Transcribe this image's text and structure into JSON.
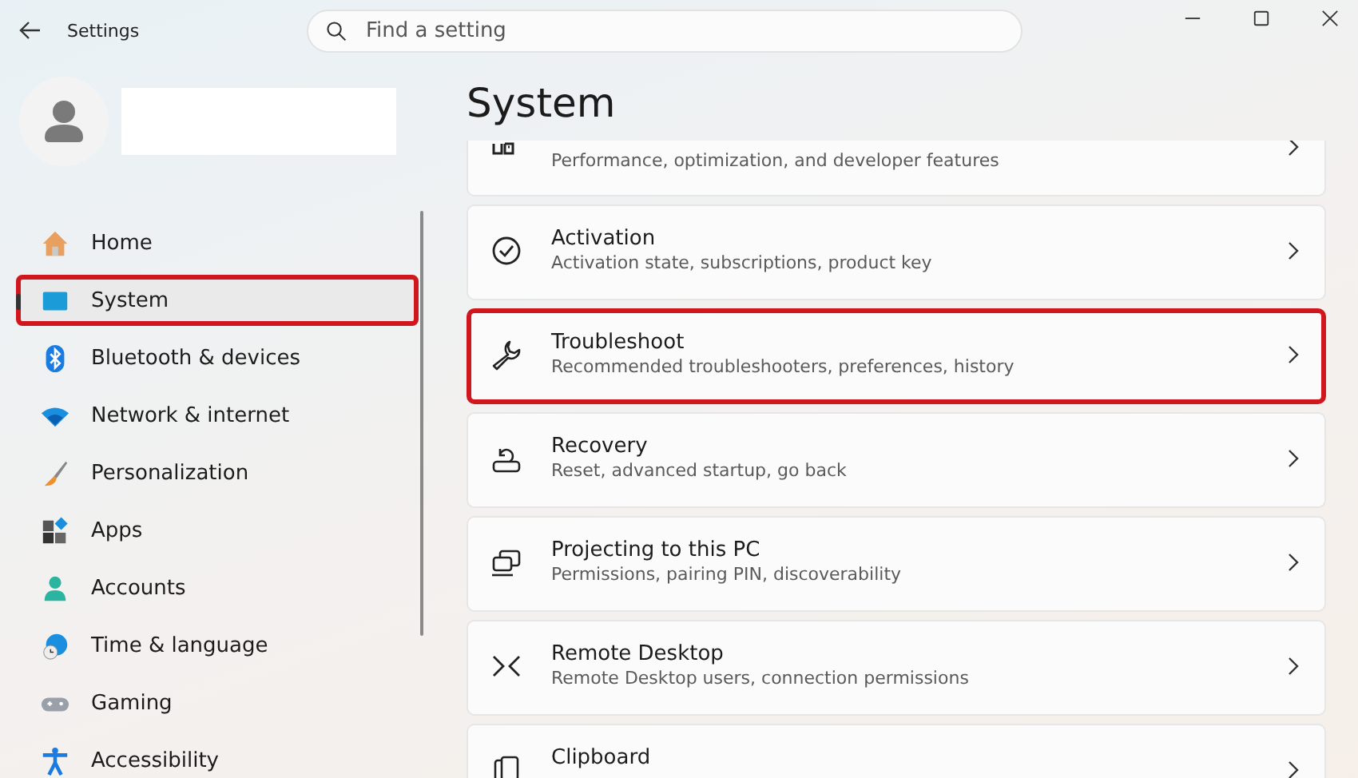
{
  "window": {
    "title": "Settings"
  },
  "search": {
    "placeholder": "Find a setting"
  },
  "account": {
    "kind": "redacted"
  },
  "sidebar": {
    "items": [
      {
        "label": "Home",
        "selected": false,
        "highlighted": false
      },
      {
        "label": "System",
        "selected": true,
        "highlighted": true
      },
      {
        "label": "Bluetooth & devices",
        "selected": false,
        "highlighted": false
      },
      {
        "label": "Network & internet",
        "selected": false,
        "highlighted": false
      },
      {
        "label": "Personalization",
        "selected": false,
        "highlighted": false
      },
      {
        "label": "Apps",
        "selected": false,
        "highlighted": false
      },
      {
        "label": "Accounts",
        "selected": false,
        "highlighted": false
      },
      {
        "label": "Time & language",
        "selected": false,
        "highlighted": false
      },
      {
        "label": "Gaming",
        "selected": false,
        "highlighted": false
      },
      {
        "label": "Accessibility",
        "selected": false,
        "highlighted": false
      }
    ]
  },
  "page": {
    "heading": "System"
  },
  "settings": [
    {
      "subtitle": "Performance, optimization, and developer features",
      "highlighted": false
    },
    {
      "title": "Activation",
      "subtitle": "Activation state, subscriptions, product key",
      "highlighted": false
    },
    {
      "title": "Troubleshoot",
      "subtitle": "Recommended troubleshooters, preferences, history",
      "highlighted": true
    },
    {
      "title": "Recovery",
      "subtitle": "Reset, advanced startup, go back",
      "highlighted": false
    },
    {
      "title": "Projecting to this PC",
      "subtitle": "Permissions, pairing PIN, discoverability",
      "highlighted": false
    },
    {
      "title": "Remote Desktop",
      "subtitle": "Remote Desktop users, connection permissions",
      "highlighted": false
    },
    {
      "title": "Clipboard",
      "highlighted": false
    }
  ]
}
